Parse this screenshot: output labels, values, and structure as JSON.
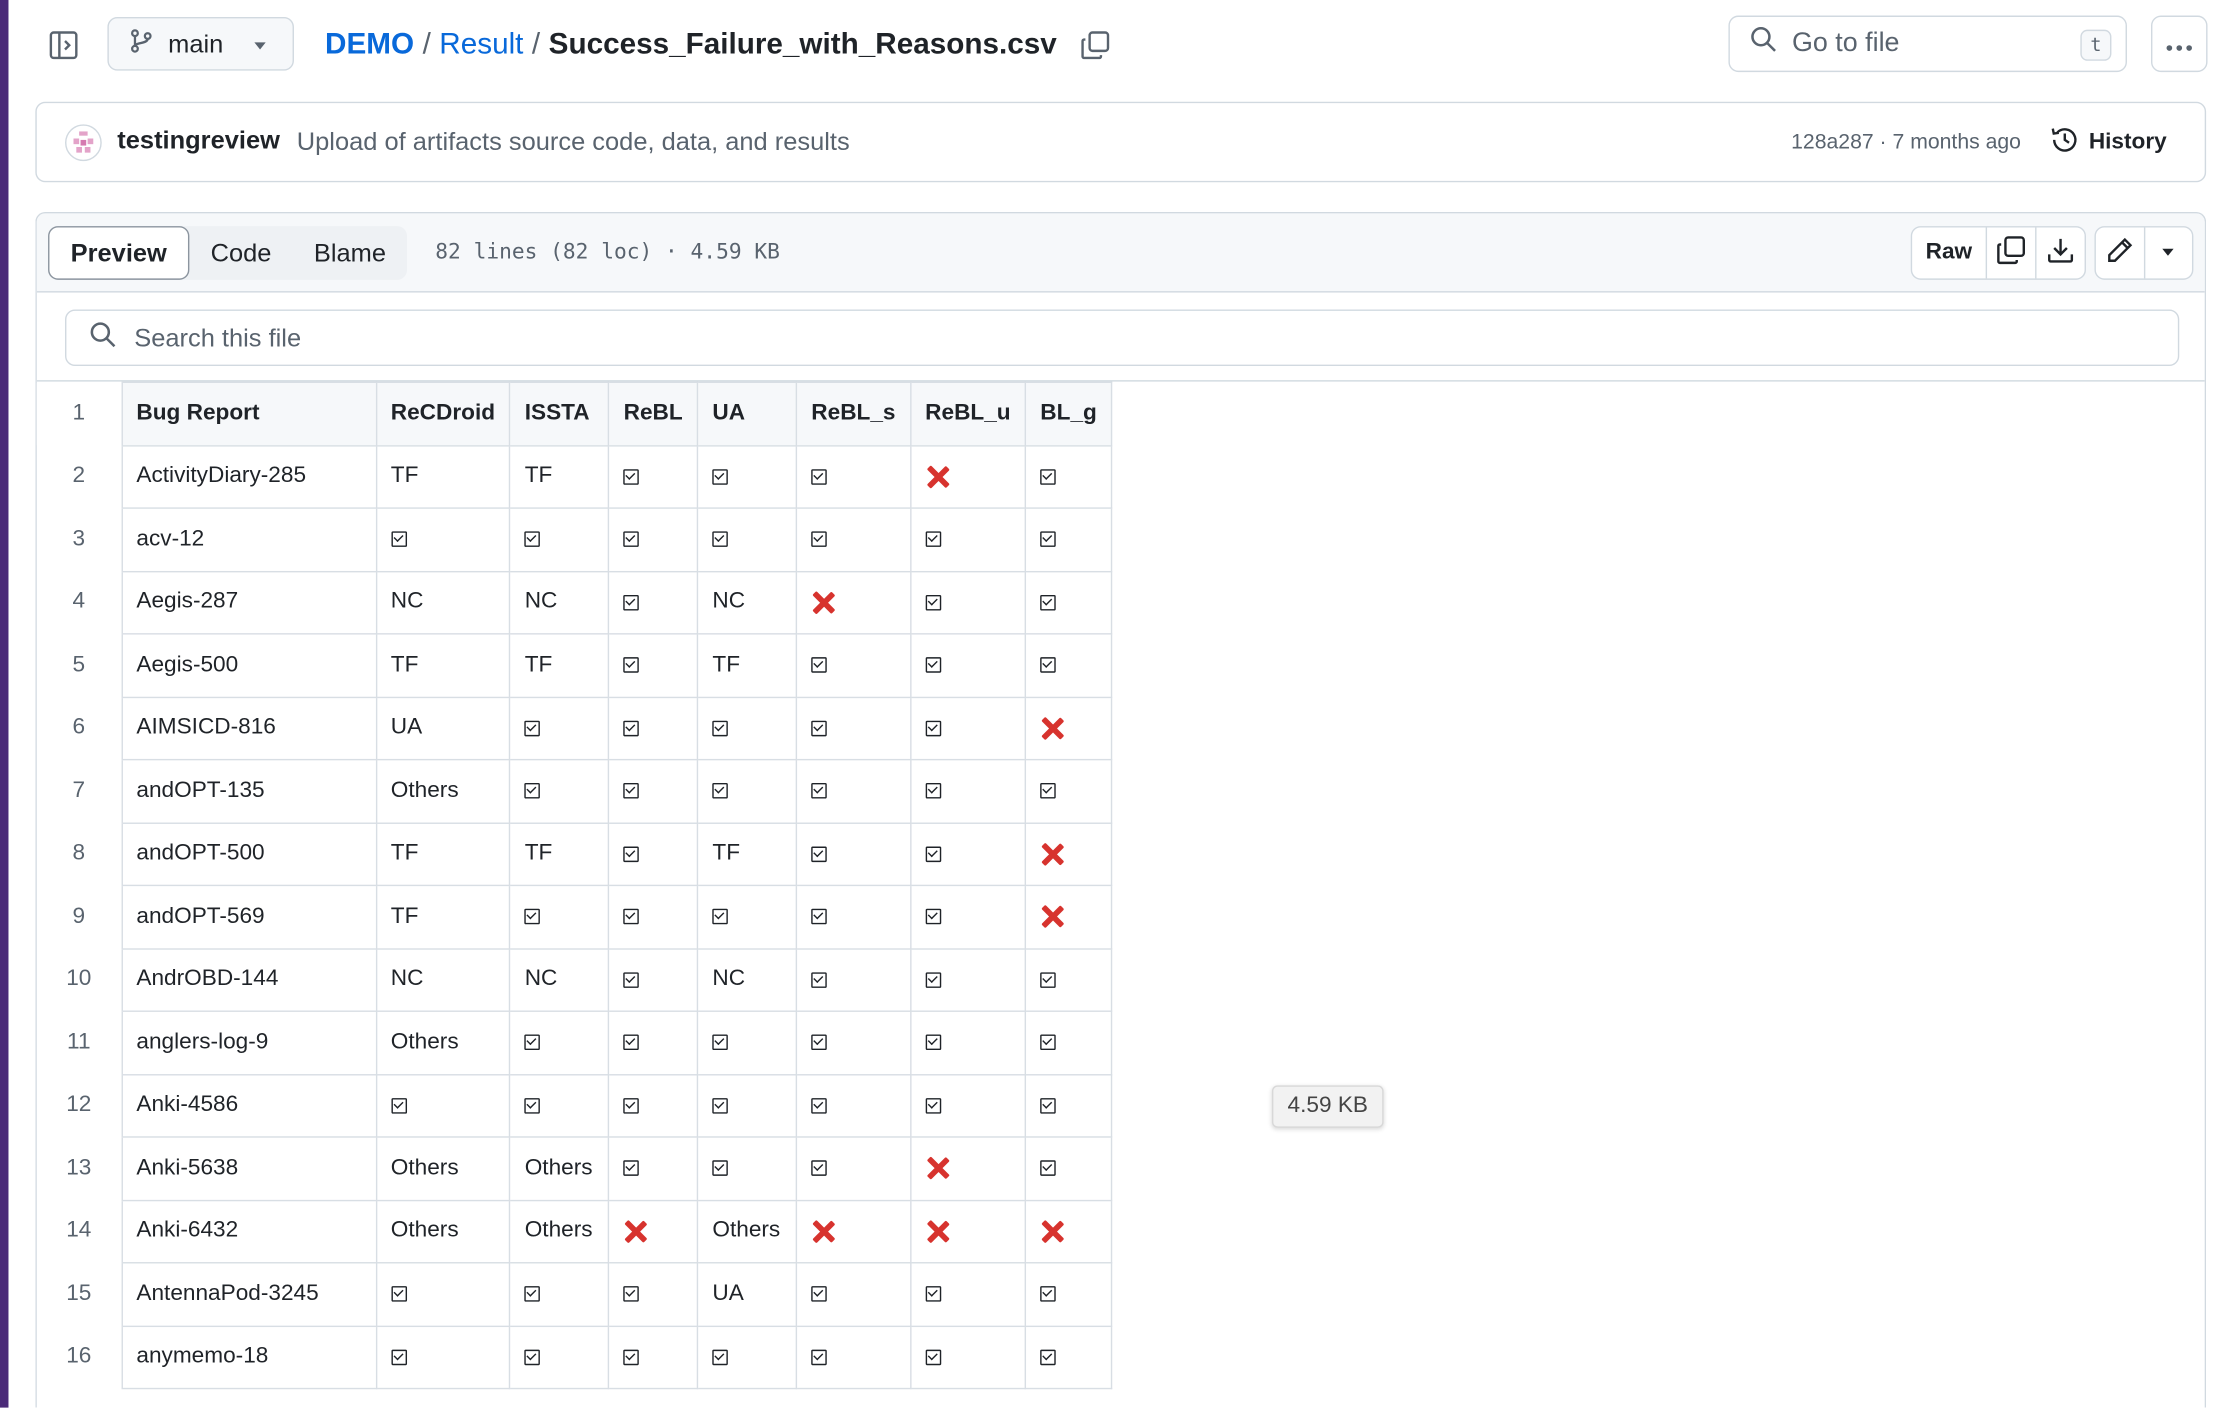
{
  "topbar": {
    "branch": "main",
    "breadcrumb": {
      "repo": "DEMO",
      "folder": "Result",
      "file": "Success_Failure_with_Reasons.csv"
    },
    "goto_placeholder": "Go to file",
    "goto_shortcut": "t"
  },
  "commit": {
    "author": "testingreview",
    "message": "Upload of artifacts source code, data, and results",
    "hash_age": "128a287 · 7 months ago",
    "history_label": "History"
  },
  "file_header": {
    "tabs": [
      "Preview",
      "Code",
      "Blame"
    ],
    "active_tab": "Preview",
    "lines_info": "82 lines (82 loc) · 4.59 KB",
    "raw_label": "Raw"
  },
  "search": {
    "placeholder": "Search this file"
  },
  "tooltip": "4.59 KB",
  "colors": {
    "accent_bar": "#4b2a78",
    "link": "#0969da",
    "fail_mark": "#d7332e"
  },
  "table": {
    "headers": [
      "Bug Report",
      "ReCDroid",
      "ISSTA",
      "ReBL",
      "UA",
      "ReBL_s",
      "ReBL_u",
      "BL_g"
    ],
    "rows": [
      [
        "ActivityDiary-285",
        "TF",
        "TF",
        "✓",
        "✓",
        "✓",
        "✗",
        "✓"
      ],
      [
        "acv-12",
        "✓",
        "✓",
        "✓",
        "✓",
        "✓",
        "✓",
        "✓"
      ],
      [
        "Aegis-287",
        "NC",
        "NC",
        "✓",
        "NC",
        "✗",
        "✓",
        "✓"
      ],
      [
        "Aegis-500",
        "TF",
        "TF",
        "✓",
        "TF",
        "✓",
        "✓",
        "✓"
      ],
      [
        "AIMSICD-816",
        "UA",
        "✓",
        "✓",
        "✓",
        "✓",
        "✓",
        "✗"
      ],
      [
        "andOPT-135",
        "Others",
        "✓",
        "✓",
        "✓",
        "✓",
        "✓",
        "✓"
      ],
      [
        "andOPT-500",
        "TF",
        "TF",
        "✓",
        "TF",
        "✓",
        "✓",
        "✗"
      ],
      [
        "andOPT-569",
        "TF",
        "✓",
        "✓",
        "✓",
        "✓",
        "✓",
        "✗"
      ],
      [
        "AndrOBD-144",
        "NC",
        "NC",
        "✓",
        "NC",
        "✓",
        "✓",
        "✓"
      ],
      [
        "anglers-log-9",
        "Others",
        "✓",
        "✓",
        "✓",
        "✓",
        "✓",
        "✓"
      ],
      [
        "Anki-4586",
        "✓",
        "✓",
        "✓",
        "✓",
        "✓",
        "✓",
        "✓"
      ],
      [
        "Anki-5638",
        "Others",
        "Others",
        "✓",
        "✓",
        "✓",
        "✗",
        "✓"
      ],
      [
        "Anki-6432",
        "Others",
        "Others",
        "✗",
        "Others",
        "✗",
        "✗",
        "✗"
      ],
      [
        "AntennaPod-3245",
        "✓",
        "✓",
        "✓",
        "UA",
        "✓",
        "✓",
        "✓"
      ],
      [
        "anymemo-18",
        "✓",
        "✓",
        "✓",
        "✓",
        "✓",
        "✓",
        "✓"
      ]
    ]
  }
}
